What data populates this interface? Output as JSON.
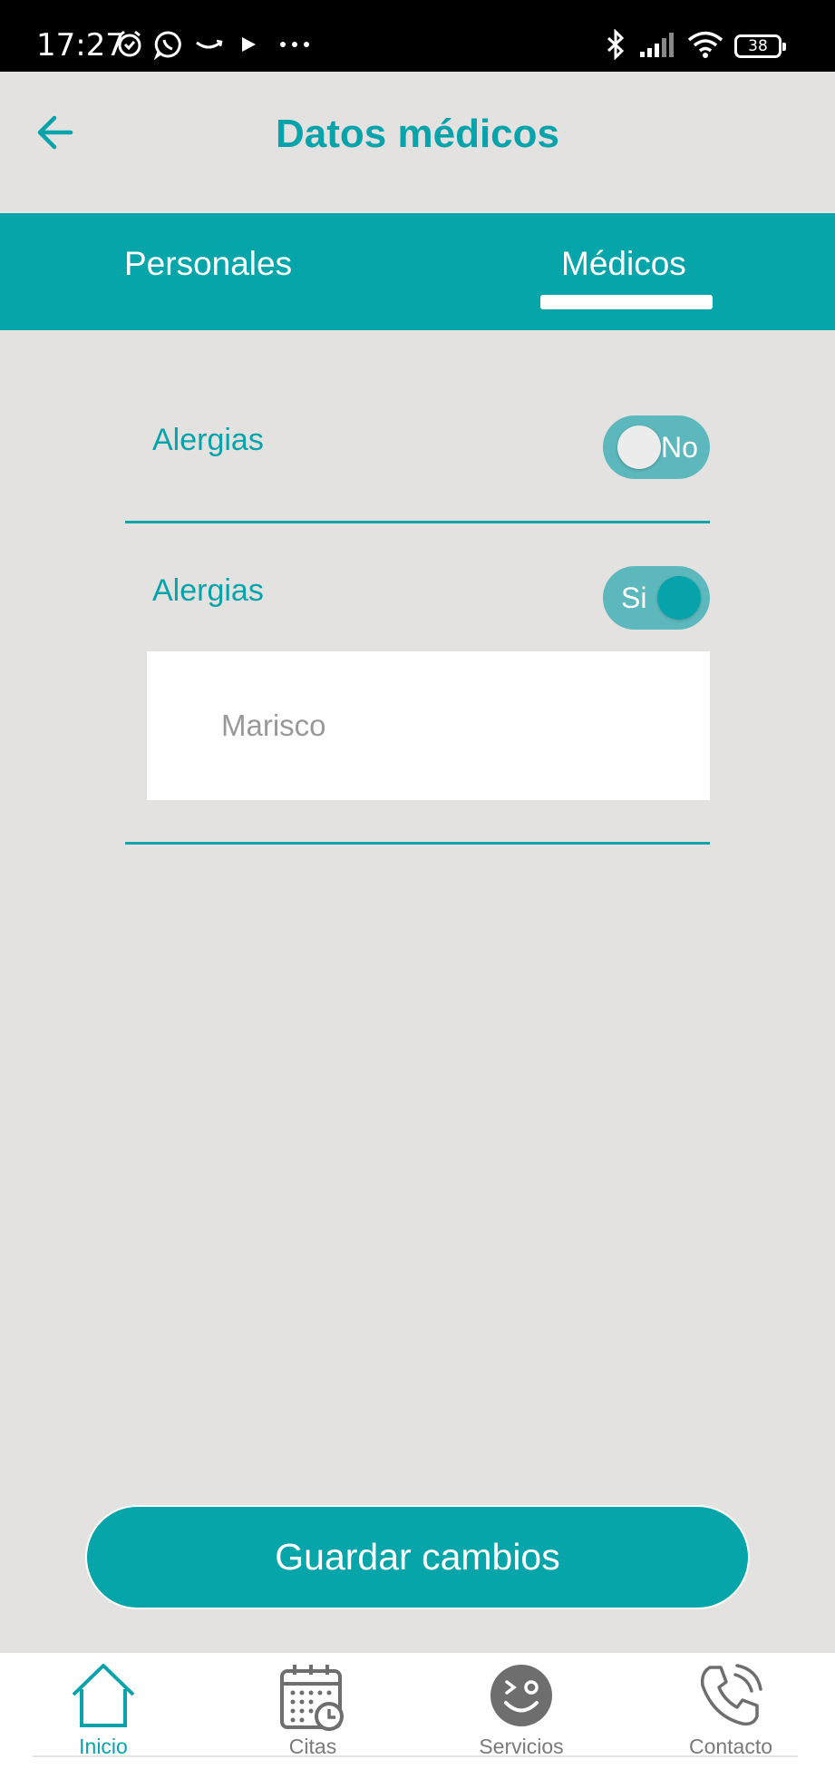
{
  "status_bar": {
    "time": "17:27",
    "battery": "38"
  },
  "header": {
    "title": "Datos médicos"
  },
  "tabs": [
    {
      "label": "Personales",
      "active": false
    },
    {
      "label": "Médicos",
      "active": true
    }
  ],
  "fields": [
    {
      "label": "Alergias",
      "toggle_text": "No",
      "on": false
    },
    {
      "label": "Alergias",
      "toggle_text": "Si",
      "on": true,
      "input_value": "Marisco"
    }
  ],
  "save_button": {
    "label": "Guardar cambios"
  },
  "bottom_nav": [
    {
      "label": "Inicio",
      "icon": "home-icon",
      "active": true
    },
    {
      "label": "Citas",
      "icon": "calendar-icon",
      "active": false
    },
    {
      "label": "Servicios",
      "icon": "smiley-icon",
      "active": false
    },
    {
      "label": "Contacto",
      "icon": "phone-icon",
      "active": false
    }
  ],
  "colors": {
    "accent": "#06a5aa",
    "background": "#e3e2e1",
    "toggle_track": "#5cb8bc"
  }
}
